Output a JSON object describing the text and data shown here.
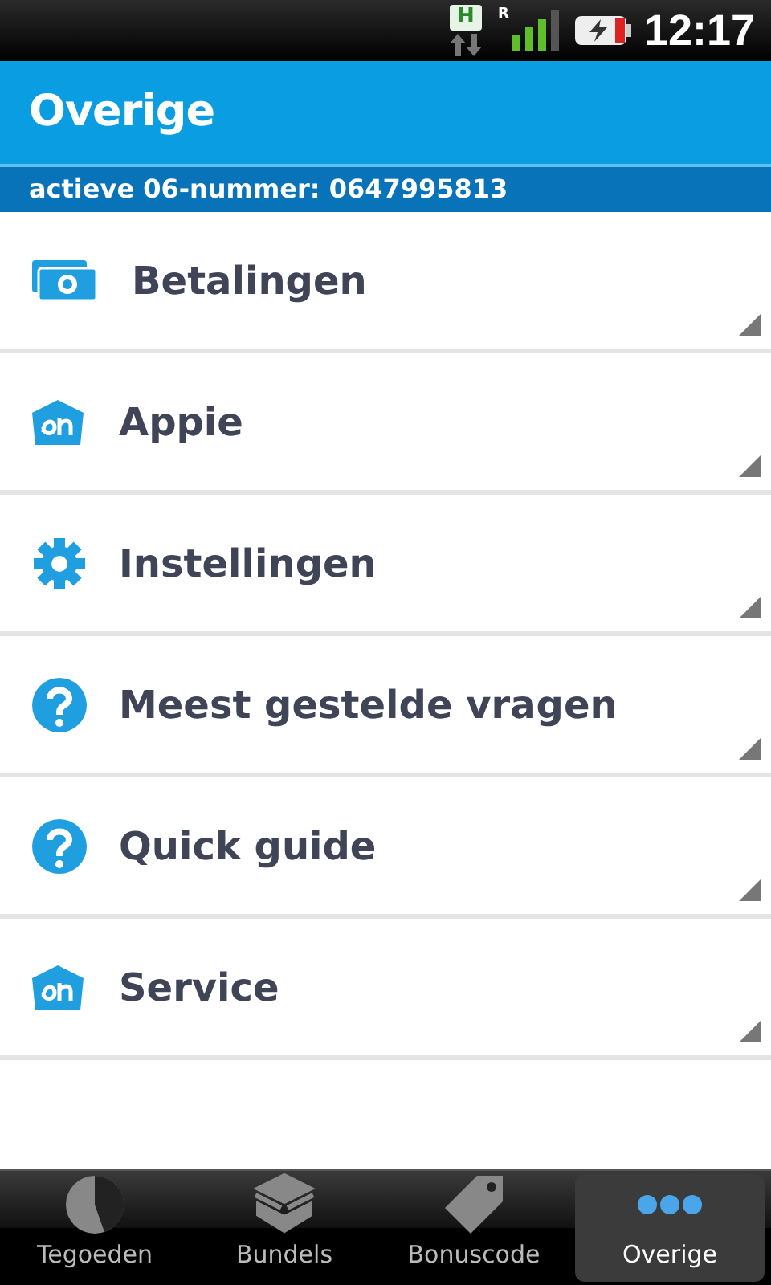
{
  "status_bar": {
    "network": "H",
    "roaming": "R",
    "time": "12:17"
  },
  "header": {
    "title": "Overige",
    "subtitle": "actieve 06-nummer: 0647995813"
  },
  "menu": [
    {
      "kind": "wallet",
      "label": "Betalingen"
    },
    {
      "kind": "logo",
      "label": "Appie"
    },
    {
      "kind": "gear",
      "label": "Instellingen"
    },
    {
      "kind": "help",
      "label": "Meest gestelde vragen"
    },
    {
      "kind": "help",
      "label": "Quick guide"
    },
    {
      "kind": "logo",
      "label": "Service"
    }
  ],
  "tabs": [
    {
      "kind": "pie",
      "label": "Tegoeden",
      "selected": false
    },
    {
      "kind": "box",
      "label": "Bundels",
      "selected": false
    },
    {
      "kind": "tag",
      "label": "Bonuscode",
      "selected": false
    },
    {
      "kind": "dots",
      "label": "Overige",
      "selected": true
    }
  ]
}
